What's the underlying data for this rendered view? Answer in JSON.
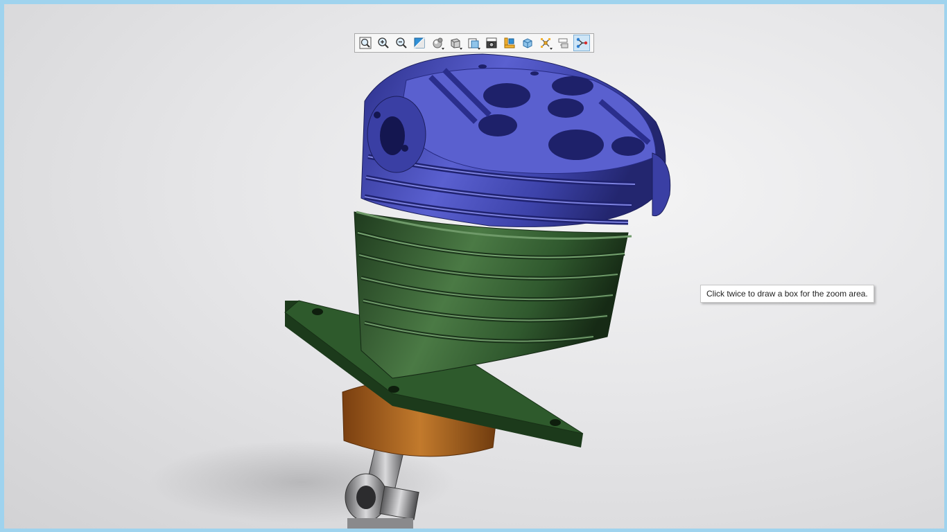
{
  "toolbar": {
    "buttons": [
      {
        "name": "zoom-to-fit",
        "icon": "zoom-fit-icon"
      },
      {
        "name": "zoom-in",
        "icon": "zoom-in-icon"
      },
      {
        "name": "zoom-out",
        "icon": "zoom-out-icon"
      },
      {
        "name": "section-view",
        "icon": "section-view-icon"
      },
      {
        "name": "display-style",
        "icon": "display-style-icon",
        "dropdown": true
      },
      {
        "name": "view-orientation",
        "icon": "view-orientation-icon",
        "dropdown": true
      },
      {
        "name": "appearance",
        "icon": "appearance-icon",
        "dropdown": true
      },
      {
        "name": "screenshot",
        "icon": "camera-icon"
      },
      {
        "name": "measure",
        "icon": "measure-icon"
      },
      {
        "name": "3d-box",
        "icon": "3d-box-icon"
      },
      {
        "name": "explode",
        "icon": "explode-icon",
        "dropdown": true
      },
      {
        "name": "show-hide",
        "icon": "show-hide-icon"
      },
      {
        "name": "markup-path",
        "icon": "path-icon",
        "active": true
      }
    ]
  },
  "tooltip": {
    "text": "Click twice to draw a box for the zoom area."
  },
  "model": {
    "head_color": "#4a4fb8",
    "cylinder_color": "#2f5a2e",
    "crankcase_color": "#b4651c",
    "rod_color": "#a9a9ab"
  }
}
